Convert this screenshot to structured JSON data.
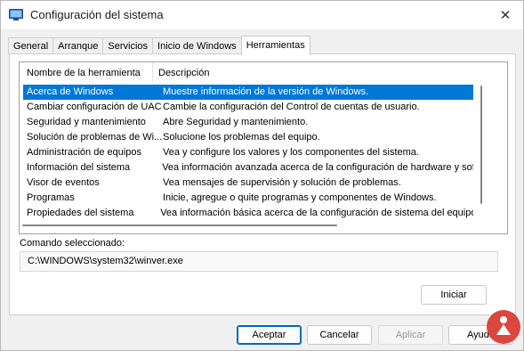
{
  "window": {
    "title": "Configuración del sistema",
    "close_glyph": "✕"
  },
  "tabs": [
    {
      "label": "General",
      "active": false
    },
    {
      "label": "Arranque",
      "active": false
    },
    {
      "label": "Servicios",
      "active": false
    },
    {
      "label": "Inicio de Windows",
      "active": false
    },
    {
      "label": "Herramientas",
      "active": true
    }
  ],
  "tools": {
    "columns": {
      "name": "Nombre de la herramienta",
      "description": "Descripción"
    },
    "rows": [
      {
        "name": "Acerca de Windows",
        "description": "Muestre información de la versión de Windows.",
        "selected": true
      },
      {
        "name": "Cambiar configuración de UAC",
        "description": "Cambie la configuración del Control de cuentas de usuario.",
        "selected": false
      },
      {
        "name": "Seguridad y mantenimiento",
        "description": "Abre Seguridad y mantenimiento.",
        "selected": false
      },
      {
        "name": "Solución de problemas de Wi...",
        "description": "Solucione los problemas del equipo.",
        "selected": false
      },
      {
        "name": "Administración de equipos",
        "description": "Vea y configure los valores y los componentes del sistema.",
        "selected": false
      },
      {
        "name": "Información del sistema",
        "description": "Vea información avanzada acerca de la configuración de hardware y sof",
        "selected": false
      },
      {
        "name": "Visor de eventos",
        "description": "Vea mensajes de supervisión y solución de problemas.",
        "selected": false
      },
      {
        "name": "Programas",
        "description": "Inicie, agregue o quite programas y componentes de Windows.",
        "selected": false
      },
      {
        "name": "Propiedades del sistema",
        "description": "Vea información básica acerca de la configuración de sistema del equipo.",
        "selected": false
      }
    ]
  },
  "command": {
    "label": "Comando seleccionado:",
    "value": "C:\\WINDOWS\\system32\\winver.exe"
  },
  "buttons": {
    "run": "Iniciar",
    "ok": "Aceptar",
    "cancel": "Cancelar",
    "apply": "Aplicar",
    "help": "Ayuda"
  },
  "colors": {
    "selection": "#0078d7",
    "default_button_border": "#0067c0",
    "watermark": "#d9473e"
  }
}
